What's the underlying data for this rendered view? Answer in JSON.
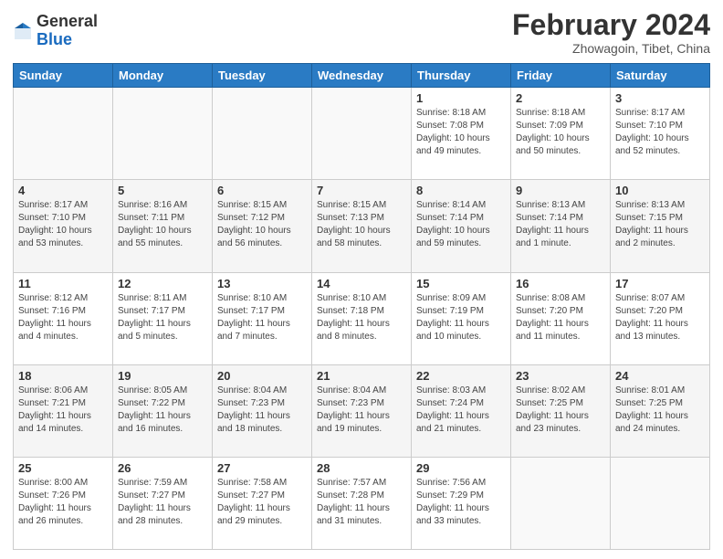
{
  "logo": {
    "general": "General",
    "blue": "Blue"
  },
  "header": {
    "month": "February 2024",
    "location": "Zhowagoin, Tibet, China"
  },
  "weekdays": [
    "Sunday",
    "Monday",
    "Tuesday",
    "Wednesday",
    "Thursday",
    "Friday",
    "Saturday"
  ],
  "weeks": [
    [
      {
        "day": "",
        "info": ""
      },
      {
        "day": "",
        "info": ""
      },
      {
        "day": "",
        "info": ""
      },
      {
        "day": "",
        "info": ""
      },
      {
        "day": "1",
        "info": "Sunrise: 8:18 AM\nSunset: 7:08 PM\nDaylight: 10 hours\nand 49 minutes."
      },
      {
        "day": "2",
        "info": "Sunrise: 8:18 AM\nSunset: 7:09 PM\nDaylight: 10 hours\nand 50 minutes."
      },
      {
        "day": "3",
        "info": "Sunrise: 8:17 AM\nSunset: 7:10 PM\nDaylight: 10 hours\nand 52 minutes."
      }
    ],
    [
      {
        "day": "4",
        "info": "Sunrise: 8:17 AM\nSunset: 7:10 PM\nDaylight: 10 hours\nand 53 minutes."
      },
      {
        "day": "5",
        "info": "Sunrise: 8:16 AM\nSunset: 7:11 PM\nDaylight: 10 hours\nand 55 minutes."
      },
      {
        "day": "6",
        "info": "Sunrise: 8:15 AM\nSunset: 7:12 PM\nDaylight: 10 hours\nand 56 minutes."
      },
      {
        "day": "7",
        "info": "Sunrise: 8:15 AM\nSunset: 7:13 PM\nDaylight: 10 hours\nand 58 minutes."
      },
      {
        "day": "8",
        "info": "Sunrise: 8:14 AM\nSunset: 7:14 PM\nDaylight: 10 hours\nand 59 minutes."
      },
      {
        "day": "9",
        "info": "Sunrise: 8:13 AM\nSunset: 7:14 PM\nDaylight: 11 hours\nand 1 minute."
      },
      {
        "day": "10",
        "info": "Sunrise: 8:13 AM\nSunset: 7:15 PM\nDaylight: 11 hours\nand 2 minutes."
      }
    ],
    [
      {
        "day": "11",
        "info": "Sunrise: 8:12 AM\nSunset: 7:16 PM\nDaylight: 11 hours\nand 4 minutes."
      },
      {
        "day": "12",
        "info": "Sunrise: 8:11 AM\nSunset: 7:17 PM\nDaylight: 11 hours\nand 5 minutes."
      },
      {
        "day": "13",
        "info": "Sunrise: 8:10 AM\nSunset: 7:17 PM\nDaylight: 11 hours\nand 7 minutes."
      },
      {
        "day": "14",
        "info": "Sunrise: 8:10 AM\nSunset: 7:18 PM\nDaylight: 11 hours\nand 8 minutes."
      },
      {
        "day": "15",
        "info": "Sunrise: 8:09 AM\nSunset: 7:19 PM\nDaylight: 11 hours\nand 10 minutes."
      },
      {
        "day": "16",
        "info": "Sunrise: 8:08 AM\nSunset: 7:20 PM\nDaylight: 11 hours\nand 11 minutes."
      },
      {
        "day": "17",
        "info": "Sunrise: 8:07 AM\nSunset: 7:20 PM\nDaylight: 11 hours\nand 13 minutes."
      }
    ],
    [
      {
        "day": "18",
        "info": "Sunrise: 8:06 AM\nSunset: 7:21 PM\nDaylight: 11 hours\nand 14 minutes."
      },
      {
        "day": "19",
        "info": "Sunrise: 8:05 AM\nSunset: 7:22 PM\nDaylight: 11 hours\nand 16 minutes."
      },
      {
        "day": "20",
        "info": "Sunrise: 8:04 AM\nSunset: 7:23 PM\nDaylight: 11 hours\nand 18 minutes."
      },
      {
        "day": "21",
        "info": "Sunrise: 8:04 AM\nSunset: 7:23 PM\nDaylight: 11 hours\nand 19 minutes."
      },
      {
        "day": "22",
        "info": "Sunrise: 8:03 AM\nSunset: 7:24 PM\nDaylight: 11 hours\nand 21 minutes."
      },
      {
        "day": "23",
        "info": "Sunrise: 8:02 AM\nSunset: 7:25 PM\nDaylight: 11 hours\nand 23 minutes."
      },
      {
        "day": "24",
        "info": "Sunrise: 8:01 AM\nSunset: 7:25 PM\nDaylight: 11 hours\nand 24 minutes."
      }
    ],
    [
      {
        "day": "25",
        "info": "Sunrise: 8:00 AM\nSunset: 7:26 PM\nDaylight: 11 hours\nand 26 minutes."
      },
      {
        "day": "26",
        "info": "Sunrise: 7:59 AM\nSunset: 7:27 PM\nDaylight: 11 hours\nand 28 minutes."
      },
      {
        "day": "27",
        "info": "Sunrise: 7:58 AM\nSunset: 7:27 PM\nDaylight: 11 hours\nand 29 minutes."
      },
      {
        "day": "28",
        "info": "Sunrise: 7:57 AM\nSunset: 7:28 PM\nDaylight: 11 hours\nand 31 minutes."
      },
      {
        "day": "29",
        "info": "Sunrise: 7:56 AM\nSunset: 7:29 PM\nDaylight: 11 hours\nand 33 minutes."
      },
      {
        "day": "",
        "info": ""
      },
      {
        "day": "",
        "info": ""
      }
    ]
  ]
}
